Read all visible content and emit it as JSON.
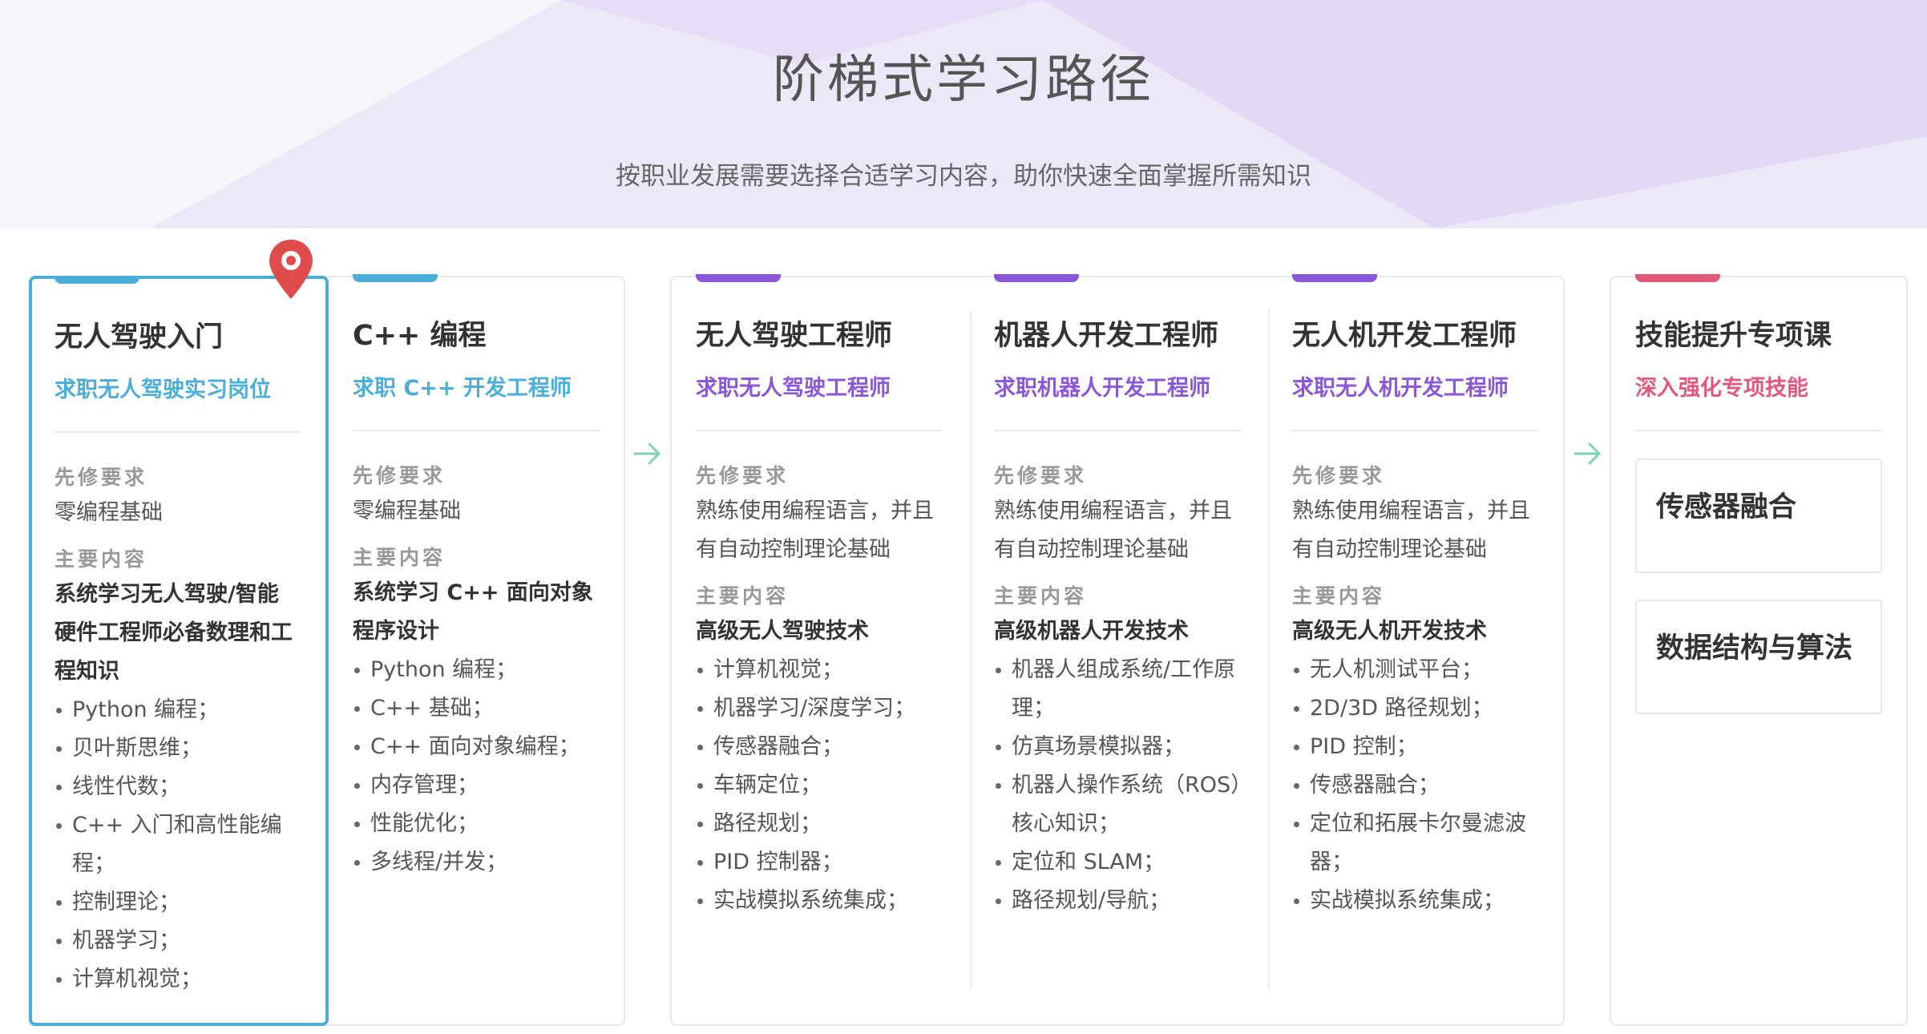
{
  "header": {
    "title": "阶梯式学习路径",
    "subtitle": "按职业发展需要选择合适学习内容，助你快速全面掌握所需知识"
  },
  "colors": {
    "blue": "#4aaed8",
    "purple": "#8a57d8",
    "pink": "#e0587a",
    "arrow": "#7fd3b4",
    "pin": "#e04b4b"
  },
  "cards": [
    {
      "title": "无人驾驶入门",
      "subtitle": "求职无人驾驶实习岗位",
      "prereq_label": "先修要求",
      "prereq": [
        "零编程基础"
      ],
      "content_label": "主要内容",
      "content_title": [
        "系统学习无人驾驶/智能",
        "硬件工程师必备数理和工",
        "程知识"
      ],
      "items": [
        "Python 编程；",
        "贝叶斯思维；",
        "线性代数；",
        "C++ 入门和高性能编程；",
        "控制理论；",
        "机器学习；",
        "计算机视觉；"
      ]
    },
    {
      "title": "C++ 编程",
      "subtitle": "求职 C++ 开发工程师",
      "prereq_label": "先修要求",
      "prereq": [
        "零编程基础"
      ],
      "content_label": "主要内容",
      "content_title": [
        "系统学习 C++ 面向对象",
        "程序设计"
      ],
      "items": [
        "Python 编程；",
        "C++ 基础；",
        "C++ 面向对象编程；",
        "内存管理；",
        "性能优化；",
        "多线程/并发；"
      ]
    },
    {
      "title": "无人驾驶工程师",
      "subtitle": "求职无人驾驶工程师",
      "prereq_label": "先修要求",
      "prereq": [
        "熟练使用编程语言，并且",
        "有自动控制理论基础"
      ],
      "content_label": "主要内容",
      "content_title": [
        "高级无人驾驶技术"
      ],
      "items": [
        "计算机视觉；",
        "机器学习/深度学习；",
        "传感器融合；",
        "车辆定位；",
        "路径规划；",
        "PID 控制器；",
        "实战模拟系统集成；"
      ]
    },
    {
      "title": "机器人开发工程师",
      "subtitle": "求职机器人开发工程师",
      "prereq_label": "先修要求",
      "prereq": [
        "熟练使用编程语言，并且",
        "有自动控制理论基础"
      ],
      "content_label": "主要内容",
      "content_title": [
        "高级机器人开发技术"
      ],
      "items": [
        "机器人组成系统/工作原",
        "仿真场景模拟器；",
        "机器人操作系统（ROS）",
        "定位和 SLAM；",
        "路径规划/导航；"
      ],
      "items_cont": [
        "理；",
        "核心知识；"
      ]
    },
    {
      "title": "无人机开发工程师",
      "subtitle": "求职无人机开发工程师",
      "prereq_label": "先修要求",
      "prereq": [
        "熟练使用编程语言，并且",
        "有自动控制理论基础"
      ],
      "content_label": "主要内容",
      "content_title": [
        "高级无人机开发技术"
      ],
      "items": [
        "无人机测试平台；",
        "2D/3D 路径规划；",
        "PID 控制；",
        "传感器融合；",
        "定位和拓展卡尔曼滤波",
        "实战模拟系统集成；"
      ],
      "items_cont": [
        "器；"
      ]
    },
    {
      "title": "技能提升专项课",
      "subtitle": "深入强化专项技能",
      "skills": [
        "传感器融合",
        "数据结构与算法"
      ]
    }
  ]
}
